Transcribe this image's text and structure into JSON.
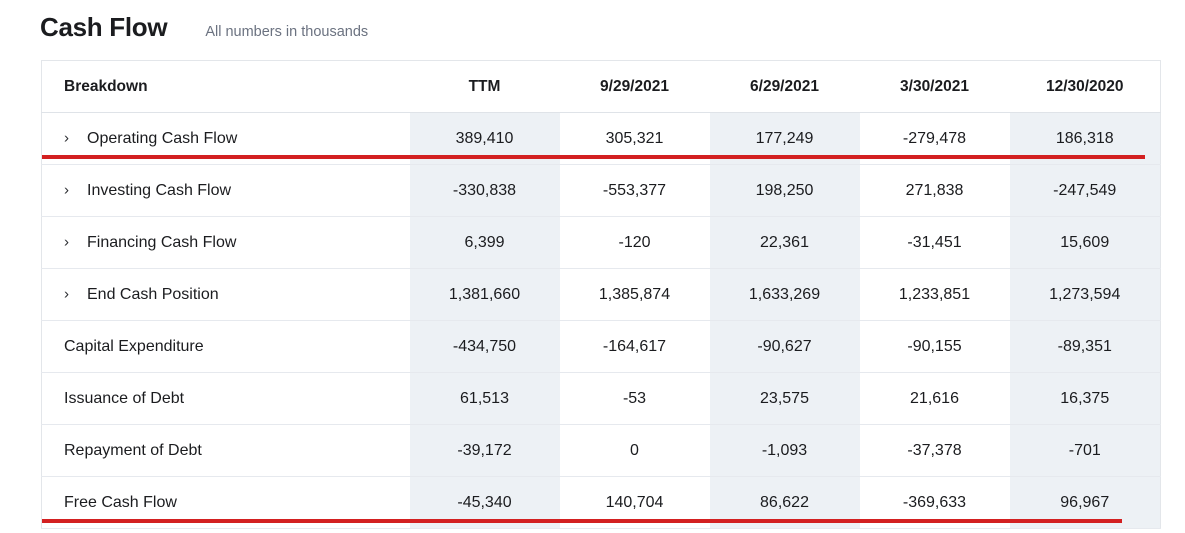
{
  "header": {
    "title": "Cash Flow",
    "subtitle": "All numbers in thousands"
  },
  "table": {
    "columns": [
      {
        "label": "Breakdown",
        "tinted": false
      },
      {
        "label": "TTM",
        "tinted": true
      },
      {
        "label": "9/29/2021",
        "tinted": false
      },
      {
        "label": "6/29/2021",
        "tinted": true
      },
      {
        "label": "3/30/2021",
        "tinted": false
      },
      {
        "label": "12/30/2020",
        "tinted": true
      }
    ],
    "rows": [
      {
        "label": "Operating Cash Flow",
        "expandable": true,
        "icon": "chevron-right-icon",
        "values": [
          "389,410",
          "305,321",
          "177,249",
          "-279,478",
          "186,318"
        ]
      },
      {
        "label": "Investing Cash Flow",
        "expandable": true,
        "icon": "chevron-right-icon",
        "values": [
          "-330,838",
          "-553,377",
          "198,250",
          "271,838",
          "-247,549"
        ]
      },
      {
        "label": "Financing Cash Flow",
        "expandable": true,
        "icon": "chevron-right-icon",
        "values": [
          "6,399",
          "-120",
          "22,361",
          "-31,451",
          "15,609"
        ]
      },
      {
        "label": "End Cash Position",
        "expandable": true,
        "icon": "chevron-right-icon",
        "values": [
          "1,381,660",
          "1,385,874",
          "1,633,269",
          "1,233,851",
          "1,273,594"
        ]
      },
      {
        "label": "Capital Expenditure",
        "expandable": false,
        "icon": "",
        "values": [
          "-434,750",
          "-164,617",
          "-90,627",
          "-90,155",
          "-89,351"
        ]
      },
      {
        "label": "Issuance of Debt",
        "expandable": false,
        "icon": "",
        "values": [
          "61,513",
          "-53",
          "23,575",
          "21,616",
          "16,375"
        ]
      },
      {
        "label": "Repayment of Debt",
        "expandable": false,
        "icon": "",
        "values": [
          "-39,172",
          "0",
          "-1,093",
          "-37,378",
          "-701"
        ]
      },
      {
        "label": "Free Cash Flow",
        "expandable": false,
        "icon": "",
        "values": [
          "-45,340",
          "140,704",
          "86,622",
          "-369,633",
          "96,967"
        ]
      }
    ]
  },
  "annotations": {
    "highlight_color": "#d32021",
    "rules": [
      {
        "name": "operating-cash-flow-underline",
        "after_row": 0
      },
      {
        "name": "free-cash-flow-underline",
        "after_row": 7
      }
    ]
  },
  "icons": {
    "chevron_right_glyph": "›"
  }
}
